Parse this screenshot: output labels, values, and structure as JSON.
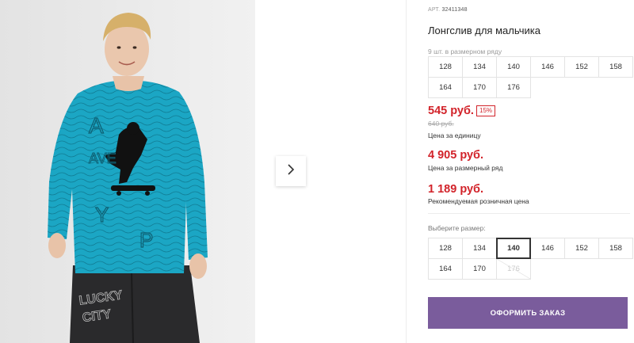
{
  "product": {
    "sku_label": "АРТ.",
    "sku_value": "32411348",
    "title": "Лонгслив для мальчика"
  },
  "size_range": {
    "caption": "9 шт. в размерном ряду",
    "sizes": [
      "128",
      "134",
      "140",
      "146",
      "152",
      "158",
      "164",
      "170",
      "176"
    ]
  },
  "prices": {
    "unit_price": "545 руб.",
    "discount": "15%",
    "old_price": "640 руб.",
    "unit_note": "Цена за единицу",
    "range_price": "4 905 руб.",
    "range_note": "Цена за размерный ряд",
    "retail_price": "1 189 руб.",
    "retail_note": "Рекомендуемая розничная цена"
  },
  "size_select": {
    "caption": "Выберите размер:",
    "sizes": [
      "128",
      "134",
      "140",
      "146",
      "152",
      "158",
      "164",
      "170",
      "176"
    ],
    "selected": "140",
    "unavailable": [
      "176"
    ]
  },
  "actions": {
    "order_label": "ОФОРМИТЬ ЗАКАЗ"
  },
  "gallery": {
    "next_icon": "chevron-right-icon",
    "shirt_print_text": "LUCKY CITY"
  },
  "colors": {
    "price_red": "#d2232a",
    "button_purple": "#7a5c9c",
    "shirt_teal": "#1ba6c4"
  }
}
